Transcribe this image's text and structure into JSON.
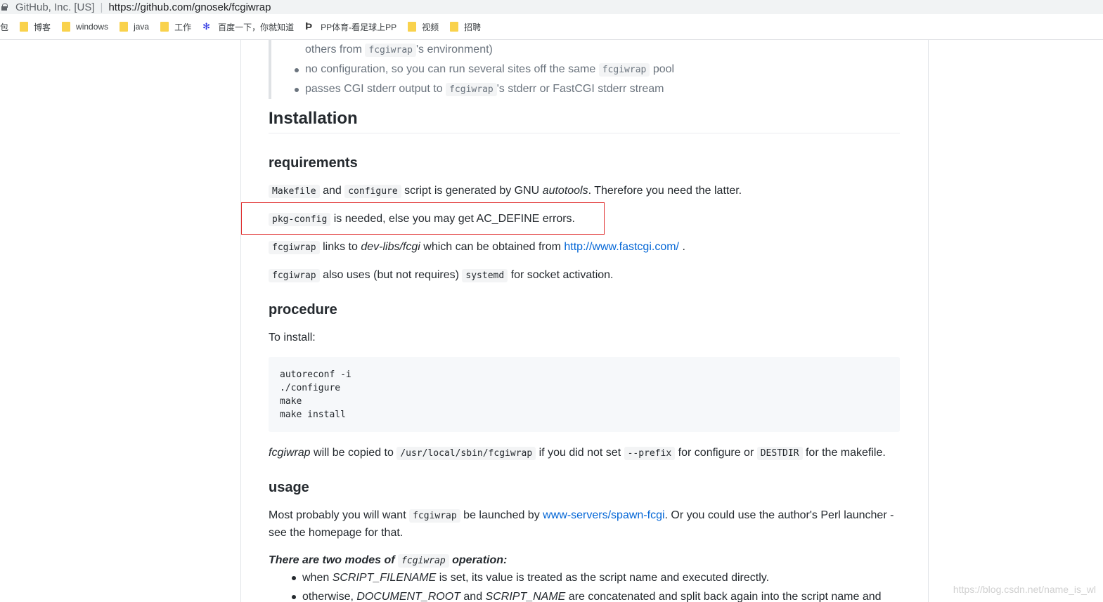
{
  "browser": {
    "site_identity": "GitHub, Inc. [US]",
    "url": "https://github.com/gnosek/fcgiwrap",
    "bookmarks_cut_label": "包",
    "bookmarks": [
      {
        "label": "博客",
        "icon": "folder-icon"
      },
      {
        "label": "windows",
        "icon": "folder-icon"
      },
      {
        "label": "java",
        "icon": "folder-icon"
      },
      {
        "label": "工作",
        "icon": "folder-icon"
      },
      {
        "label": "百度一下，你就知道",
        "icon": "baidu-icon"
      },
      {
        "label": "PP体育-看足球上PP",
        "icon": "pp-icon"
      },
      {
        "label": "视频",
        "icon": "folder-icon"
      },
      {
        "label": "招聘",
        "icon": "folder-icon"
      }
    ]
  },
  "readme": {
    "quote": {
      "line1_prefix": "others from",
      "line1_code": "fcgiwrap",
      "line1_suffix": "'s environment)",
      "item2_prefix": "no configuration, so you can run several sites off the same",
      "item2_code": "fcgiwrap",
      "item2_suffix": "pool",
      "item3_prefix": "passes CGI stderr output to",
      "item3_code": "fcgiwrap",
      "item3_suffix": "'s stderr or FastCGI stderr stream"
    },
    "installation_heading": "Installation",
    "requirements_heading": "requirements",
    "req1": {
      "code1": "Makefile",
      "t1": "and",
      "code2": "configure",
      "t2": "script is generated by GNU",
      "em": "autotools",
      "t3": ". Therefore you need the latter."
    },
    "req2": {
      "code": "pkg-config",
      "text": "is needed, else you may get AC_DEFINE errors."
    },
    "req3": {
      "code": "fcgiwrap",
      "t1": "links to",
      "em": "dev-libs/fcgi",
      "t2": "which can be obtained from",
      "link": "http://www.fastcgi.com/",
      "t3": "."
    },
    "req4": {
      "code1": "fcgiwrap",
      "t1": "also uses (but not requires)",
      "code2": "systemd",
      "t2": "for socket activation."
    },
    "procedure_heading": "procedure",
    "to_install": "To install:",
    "install_code": [
      "autoreconf -i",
      "./configure",
      "make",
      "make install"
    ],
    "copied": {
      "em": "fcgiwrap",
      "t1": "will be copied to",
      "code1": "/usr/local/sbin/fcgiwrap",
      "t2": "if you did not set",
      "code2": "--prefix",
      "t3": "for configure or",
      "code3": "DESTDIR",
      "t4": "for the makefile."
    },
    "usage_heading": "usage",
    "usage": {
      "t1": "Most probably you will want",
      "code": "fcgiwrap",
      "t2": "be launched by",
      "link": "www-servers/spawn-fcgi",
      "t3": ". Or you could use the author's Perl launcher -",
      "t4": "see the homepage for that."
    },
    "modes": {
      "t1": "There are two modes of",
      "code": "fcgiwrap",
      "t2": "operation:"
    },
    "mode1": {
      "t1": "when",
      "em": "SCRIPT_FILENAME",
      "t2": "is set, its value is treated as the script name and executed directly."
    },
    "mode2": {
      "t1": "otherwise,",
      "em1": "DOCUMENT_ROOT",
      "t2": "and",
      "em2": "SCRIPT_NAME",
      "t3": "are concatenated and split back again into the script name and"
    }
  },
  "watermark": "https://blog.csdn.net/name_is_wl"
}
